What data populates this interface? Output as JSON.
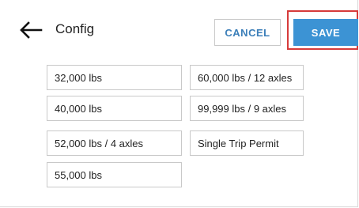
{
  "header": {
    "title": "Config",
    "back_icon": "arrow-left-icon",
    "cancel_label": "CANCEL",
    "save_label": "SAVE"
  },
  "options": {
    "left": [
      "32,000 lbs",
      "40,000 lbs",
      "52,000 lbs / 4 axles",
      "55,000 lbs"
    ],
    "right": [
      "60,000 lbs / 12 axles",
      "99,999 lbs / 9 axles",
      "Single Trip Permit"
    ]
  },
  "colors": {
    "save_bg": "#3c93d4",
    "cancel_text": "#3c7fb9",
    "highlight_border": "#d63b3b",
    "option_border": "#c9c9c9"
  }
}
